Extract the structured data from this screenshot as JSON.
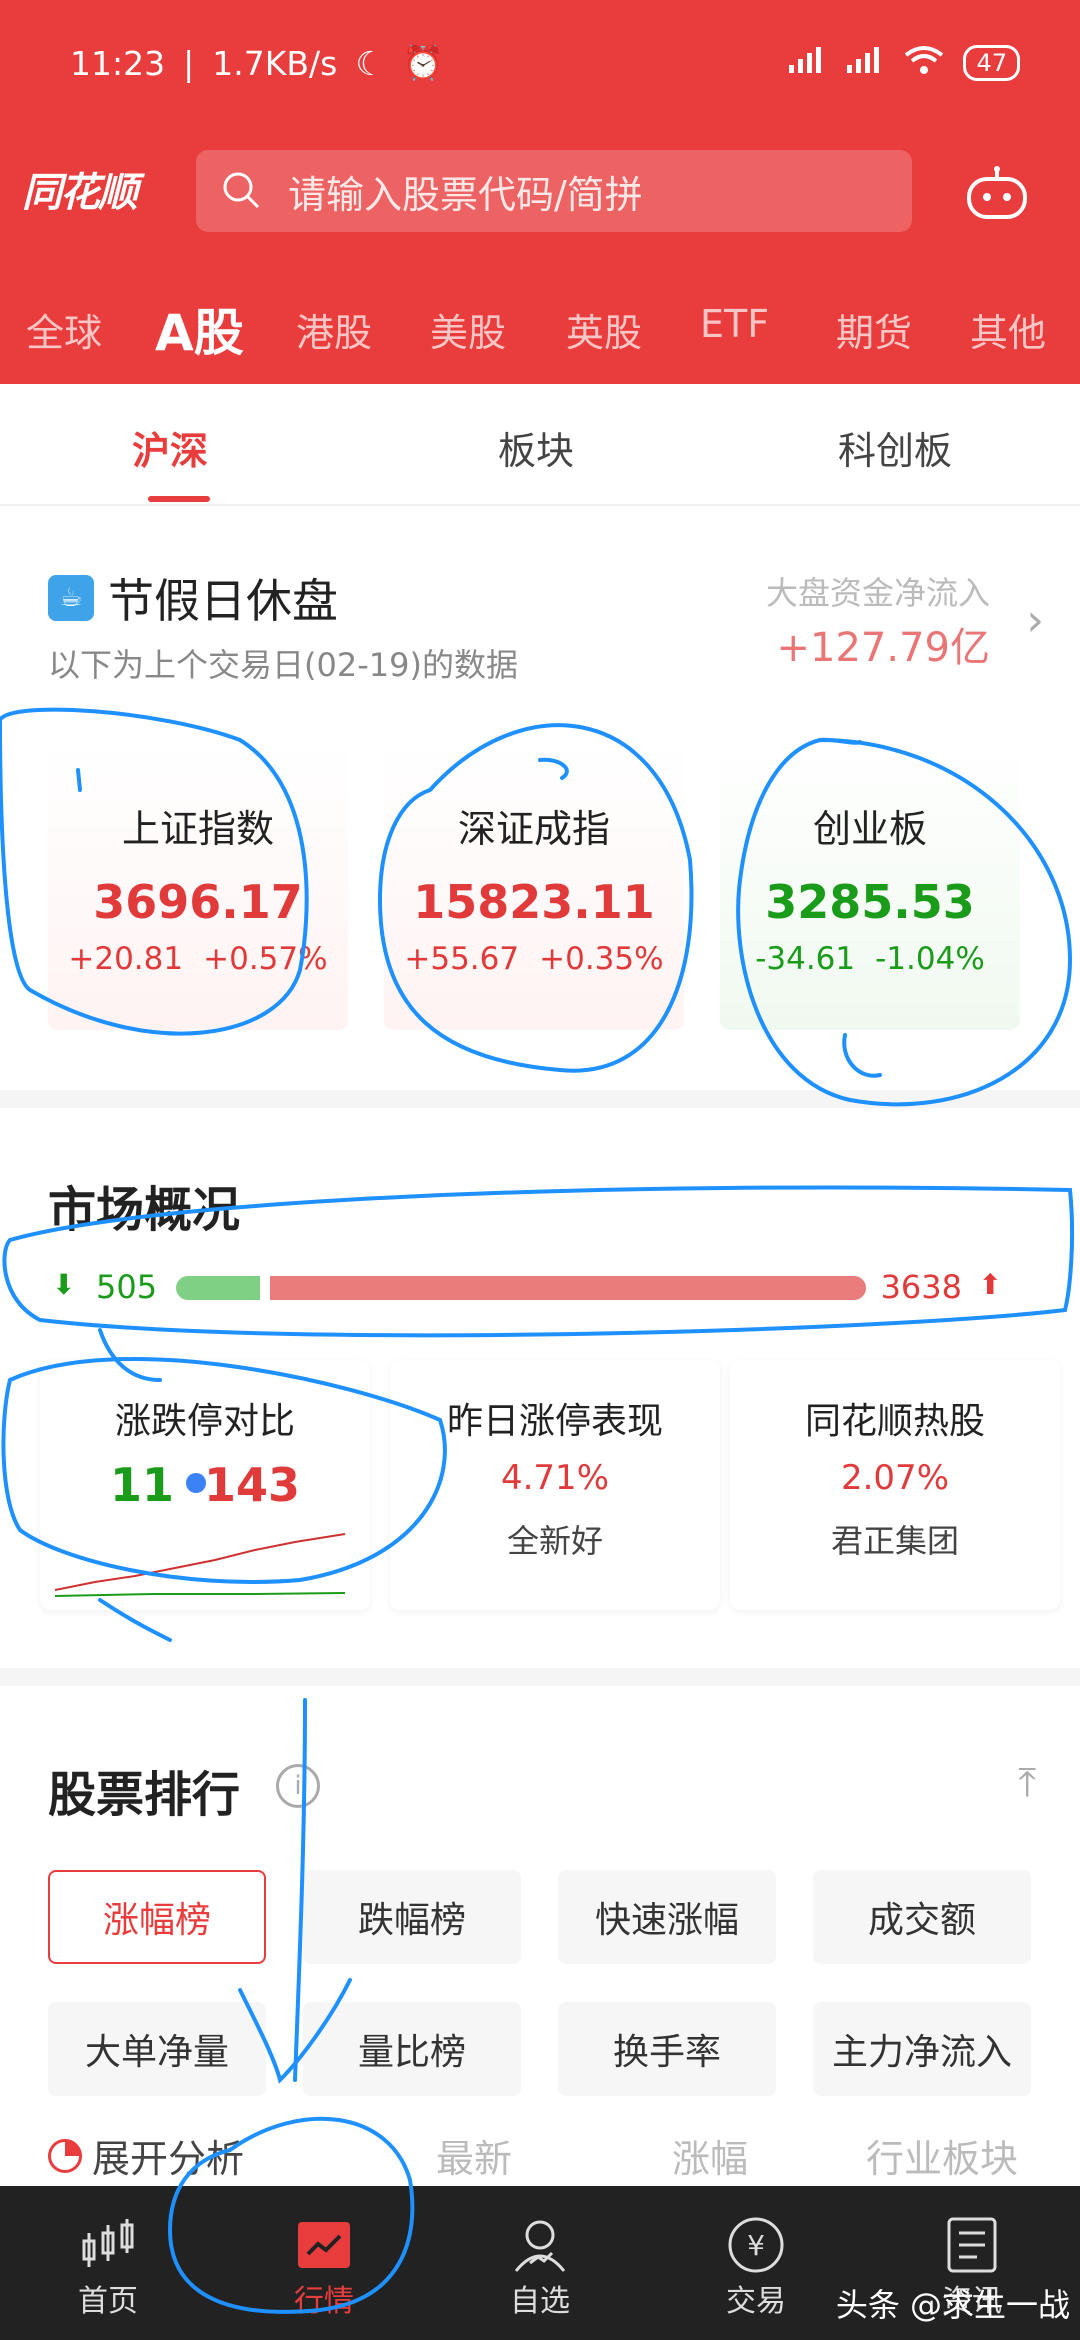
{
  "status": {
    "time": "11:23",
    "speed": "1.7KB/s",
    "battery": "47"
  },
  "header": {
    "logo": "同花顺",
    "search_placeholder": "请输入股票代码/简拼"
  },
  "market_tabs": [
    "全球",
    "A股",
    "港股",
    "美股",
    "英股",
    "ETF",
    "期货",
    "其他"
  ],
  "sub_tabs": [
    "沪深",
    "板块",
    "科创板"
  ],
  "holiday": {
    "icon": "☕",
    "title": "节假日休盘",
    "subtitle": "以下为上个交易日(02-19)的数据",
    "flow_label": "大盘资金净流入",
    "flow_value": "+127.79亿",
    "arrow": "›"
  },
  "indices": [
    {
      "name": "上证指数",
      "value": "3696.17",
      "change": "+20.81",
      "pct": "+0.57%"
    },
    {
      "name": "深证成指",
      "value": "15823.11",
      "change": "+55.67",
      "pct": "+0.35%"
    },
    {
      "name": "创业板",
      "value": "3285.53",
      "change": "-34.61",
      "pct": "-1.04%"
    }
  ],
  "market": {
    "title": "市场概况",
    "down_count": "505",
    "up_count": "3638",
    "down_fraction": 0.122,
    "cards": [
      {
        "name": "涨跌停对比",
        "down": "11",
        "up": "143"
      },
      {
        "name": "昨日涨停表现",
        "value": "4.71%",
        "sub": "全新好"
      },
      {
        "name": "同花顺热股",
        "value": "2.07%",
        "sub": "君正集团"
      }
    ]
  },
  "ranking": {
    "title": "股票排行",
    "info_icon": "i",
    "collapse_icon": "⤒",
    "chips": [
      "涨幅榜",
      "跌幅榜",
      "快速涨幅",
      "成交额",
      "大单净量",
      "量比榜",
      "换手率",
      "主力净流入"
    ],
    "expand_label": "展开分析",
    "columns": [
      "最新",
      "涨幅",
      "行业板块"
    ]
  },
  "bottom_nav": [
    "首页",
    "行情",
    "自选",
    "交易",
    "资讯"
  ],
  "watermark": "头条 @求生一战",
  "colors": {
    "brand_red": "#e93c3c",
    "up": "#e03a3a",
    "down": "#1a9b1a",
    "annotation": "#1e90ff"
  }
}
